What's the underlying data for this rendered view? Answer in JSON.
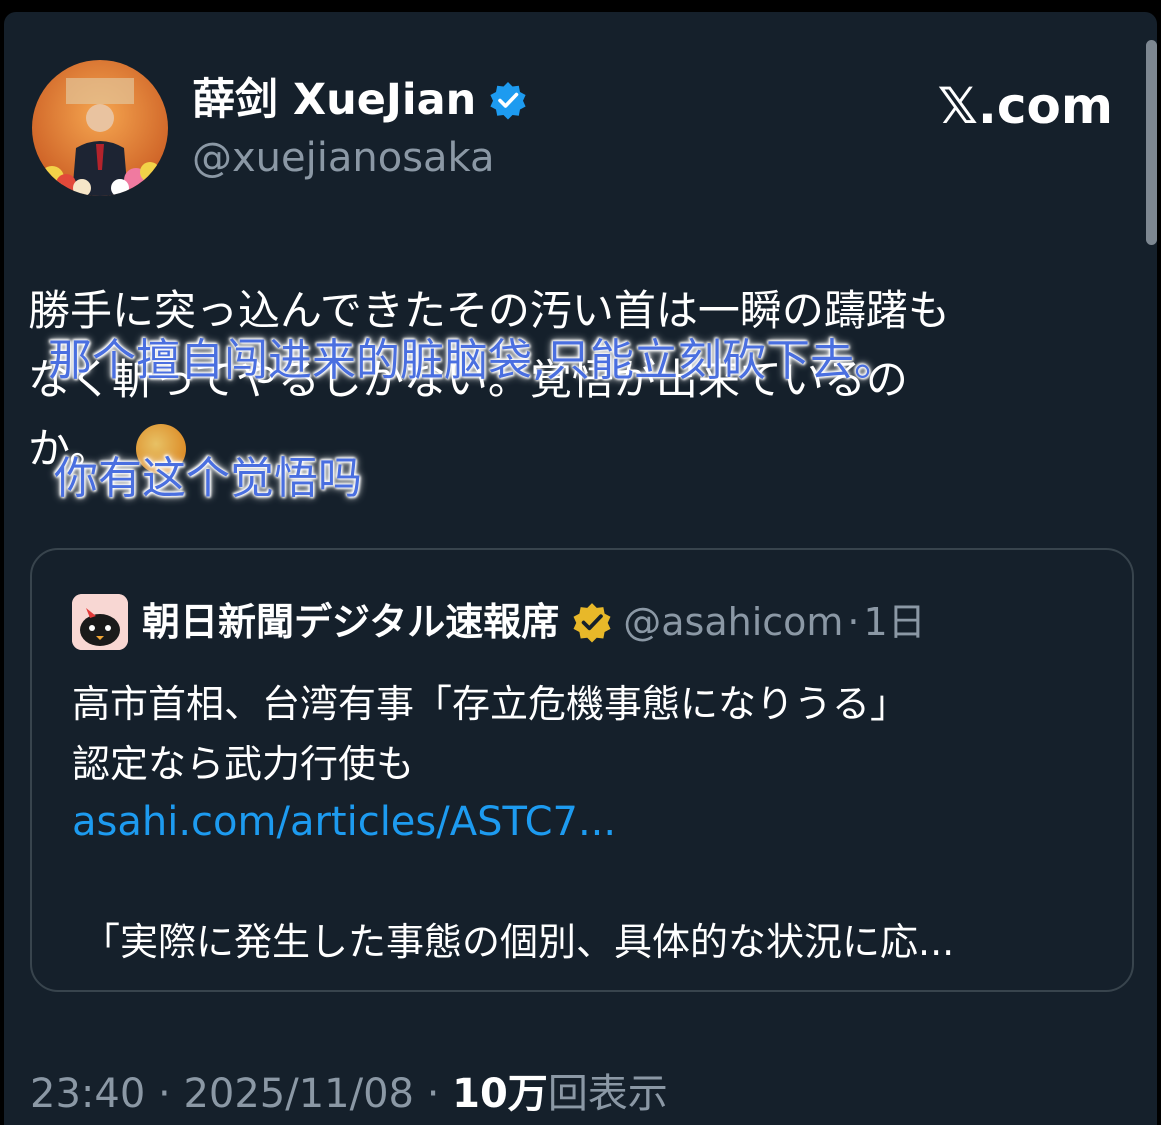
{
  "author": {
    "name": "薛剑 XueJian",
    "handle": "@xuejianosaka"
  },
  "site_label": "𝕏.com",
  "tweet": {
    "text": "勝手に突っ込んできたその汚い首は一瞬の躊躇も\nなく斬ってやるしかない。覚悟が出来ているの\nか。"
  },
  "overlay": {
    "line1": "那个擅自闯进来的脏脑袋,只能立刻砍下去。",
    "line2": "你有这个觉悟吗"
  },
  "quoted": {
    "name": "朝日新聞デジタル速報席",
    "handle": "@asahicom",
    "separator": "·",
    "time": "1日",
    "text": "高市首相、台湾有事「存立危機事態になりうる」\n認定なら武力行使も",
    "link": "asahi.com/articles/ASTC7...",
    "excerpt": "「実際に発生した事態の個別、具体的な状況に応..."
  },
  "footer": {
    "time": "23:40",
    "dot": "·",
    "date": "2025/11/08",
    "dot2": "·",
    "views_count": "10万",
    "views_label": "回表示"
  },
  "colors": {
    "background": "#15202b",
    "verified_blue": "#1d9bf0",
    "gold_badge": "#e8b829",
    "link": "#1d9bf0",
    "overlay_text": "#4a6fe0"
  }
}
